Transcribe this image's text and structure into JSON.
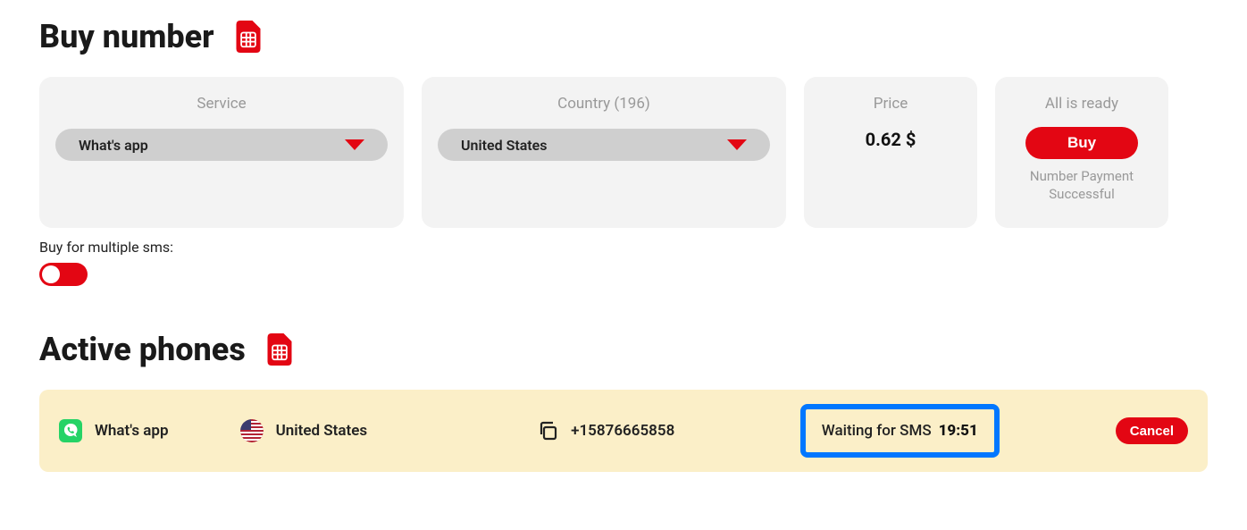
{
  "buySection": {
    "title": "Buy number",
    "serviceLabel": "Service",
    "serviceValue": "What's app",
    "countryLabel": "Country (196)",
    "countryValue": "United States",
    "priceLabel": "Price",
    "priceValue": "0.62 $",
    "readyLabel": "All is ready",
    "buyButton": "Buy",
    "readyStatus": "Number Payment Successful"
  },
  "multiSms": {
    "label": "Buy for multiple sms:"
  },
  "activeSection": {
    "title": "Active phones"
  },
  "activePhone": {
    "service": "What's app",
    "country": "United States",
    "number": "+15876665858",
    "statusLabel": "Waiting for SMS",
    "timer": "19:51",
    "cancel": "Cancel"
  }
}
